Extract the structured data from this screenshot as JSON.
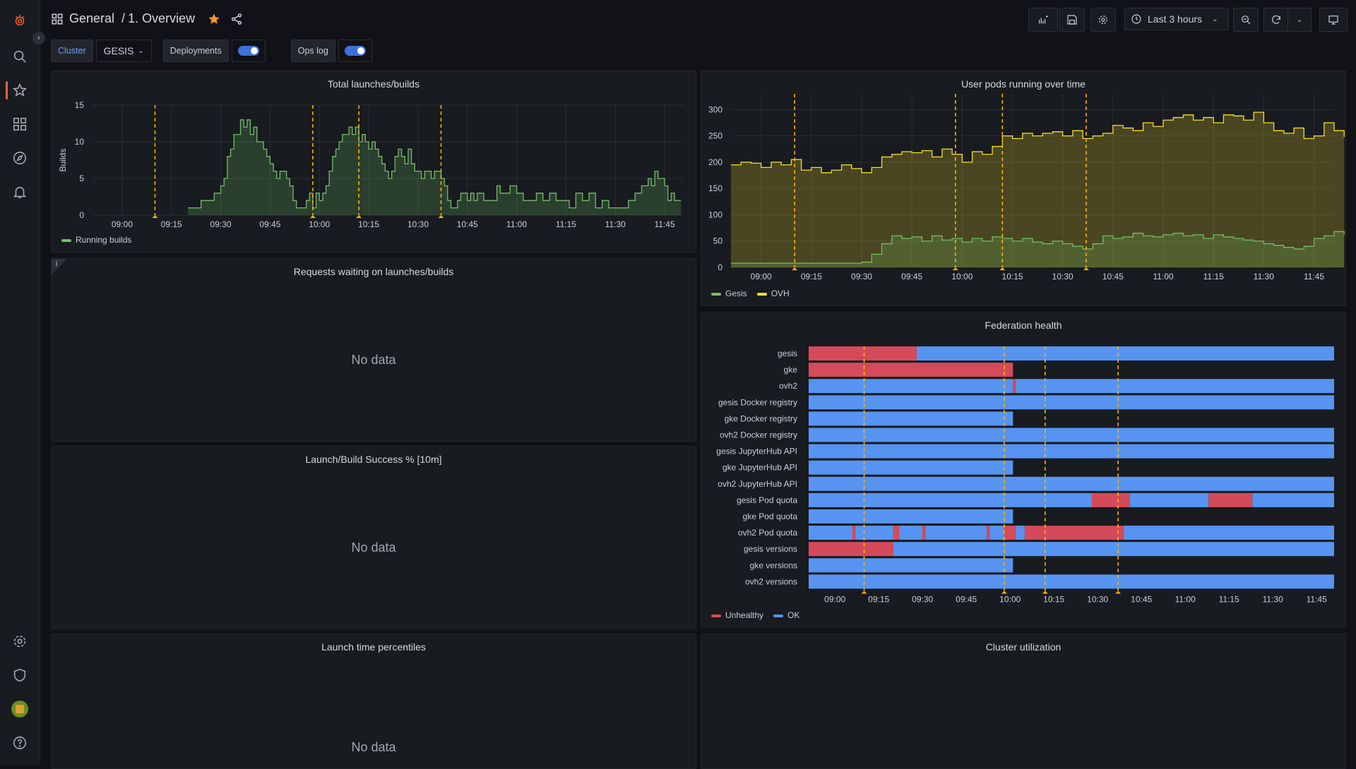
{
  "nav": {
    "icons": [
      "grafana-logo-icon",
      "search-icon",
      "starred-icon",
      "dashboards-icon",
      "explore-icon",
      "alerting-icon",
      "configuration-icon",
      "server-admin-icon",
      "user-avatar-icon",
      "help-icon"
    ]
  },
  "header": {
    "breadcrumb_folder": "General",
    "breadcrumb_sep": "/",
    "title": "1. Overview",
    "time_range": "Last 3 hours"
  },
  "variables": {
    "cluster_label": "Cluster",
    "cluster_value": "GESIS",
    "deployments_label": "Deployments",
    "opslog_label": "Ops log"
  },
  "panels": {
    "launches": {
      "title": "Total launches/builds",
      "legend": "Running builds"
    },
    "requests": {
      "title": "Requests waiting on launches/builds",
      "info": "i",
      "empty": "No data"
    },
    "success": {
      "title": "Launch/Build Success % [10m]",
      "empty": "No data"
    },
    "percentiles": {
      "title": "Launch time percentiles",
      "empty": "No data"
    },
    "userpods": {
      "title": "User pods running over time",
      "legend": [
        "Gesis",
        "OVH"
      ]
    },
    "federation": {
      "title": "Federation health",
      "legend": [
        "Unhealthy",
        "OK"
      ]
    },
    "utilization": {
      "title": "Cluster utilization"
    }
  },
  "colors": {
    "green": "#73bf69",
    "yellow": "#fade2a",
    "red": "#d44a5a",
    "blue": "#5794f2",
    "annotation": "#ffb200"
  },
  "chart_data": [
    {
      "type": "area",
      "title": "Total launches/builds",
      "ylabel": "Builds",
      "ylim": [
        0,
        15
      ],
      "yticks": [
        "0",
        "5",
        "10",
        "15"
      ],
      "xticks": [
        "09:00",
        "09:15",
        "09:30",
        "09:45",
        "10:00",
        "10:15",
        "10:30",
        "10:45",
        "11:00",
        "11:15",
        "11:30",
        "11:45"
      ],
      "x_unit_minutes": [
        0,
        15,
        30,
        45,
        60,
        75,
        90,
        105,
        120,
        135,
        150,
        165
      ],
      "annotations_minutes": [
        10,
        58,
        72,
        97
      ],
      "series": [
        {
          "name": "Running builds",
          "x": [
            20,
            24,
            28,
            30,
            31,
            32,
            33,
            34,
            35,
            36,
            37,
            38,
            39,
            40,
            41,
            42,
            43,
            44,
            45,
            46,
            47,
            48,
            49,
            50,
            51,
            52,
            53,
            54,
            55,
            56,
            57,
            58,
            59,
            60,
            61,
            62,
            63,
            64,
            65,
            66,
            67,
            68,
            69,
            70,
            71,
            72,
            73,
            74,
            75,
            76,
            77,
            78,
            79,
            80,
            81,
            82,
            83,
            84,
            85,
            86,
            87,
            88,
            89,
            90,
            91,
            92,
            93,
            94,
            95,
            96,
            97,
            98,
            99,
            100,
            101,
            102,
            103,
            104,
            105,
            106,
            107,
            108,
            110,
            112,
            114,
            115,
            116,
            118,
            120,
            122,
            124,
            126,
            128,
            130,
            132,
            134,
            136,
            138,
            140,
            142,
            144,
            146,
            148,
            150,
            152,
            154,
            156,
            158,
            160,
            161,
            162,
            163,
            164,
            165,
            166,
            167,
            168,
            170
          ],
          "y": [
            1,
            2,
            3,
            4,
            5,
            8,
            9,
            11,
            11,
            13,
            12,
            13,
            11,
            12,
            10,
            10,
            9,
            8,
            7,
            6,
            5,
            6,
            6,
            5,
            4,
            2,
            1,
            1,
            1,
            2,
            3,
            1,
            3,
            2,
            3,
            4,
            6,
            8,
            9,
            10,
            11,
            11,
            12,
            11,
            12,
            10,
            11,
            10,
            9,
            10,
            9,
            8,
            7,
            6,
            5,
            6,
            8,
            9,
            8,
            7,
            9,
            7,
            6,
            6,
            5,
            6,
            6,
            5,
            6,
            6,
            5,
            4,
            2,
            1,
            1,
            2,
            3,
            3,
            2,
            3,
            2,
            3,
            2,
            2,
            4,
            3,
            3,
            4,
            3,
            2,
            2,
            3,
            2,
            3,
            2,
            2,
            1,
            3,
            2,
            3,
            1,
            2,
            1,
            1,
            1,
            2,
            3,
            4,
            5,
            4,
            6,
            5,
            5,
            4,
            2,
            3,
            2,
            2
          ]
        }
      ]
    },
    {
      "type": "area",
      "title": "User pods running over time",
      "ylim": [
        0,
        330
      ],
      "yticks": [
        "0",
        "50",
        "100",
        "150",
        "200",
        "250",
        "300"
      ],
      "xticks": [
        "09:00",
        "09:15",
        "09:30",
        "09:45",
        "10:00",
        "10:15",
        "10:30",
        "10:45",
        "11:00",
        "11:15",
        "11:30",
        "11:45"
      ],
      "x_unit_minutes": [
        0,
        15,
        30,
        45,
        60,
        75,
        90,
        105,
        120,
        135,
        150,
        165
      ],
      "annotations_minutes": [
        10,
        58,
        72,
        97
      ],
      "series": [
        {
          "name": "OVH",
          "x": [
            -9,
            -6,
            -3,
            0,
            3,
            6,
            9,
            12,
            15,
            18,
            21,
            24,
            27,
            30,
            33,
            36,
            39,
            42,
            45,
            48,
            51,
            54,
            57,
            60,
            63,
            66,
            69,
            72,
            75,
            78,
            81,
            84,
            87,
            90,
            93,
            96,
            99,
            102,
            105,
            108,
            111,
            114,
            117,
            120,
            123,
            126,
            129,
            132,
            135,
            138,
            141,
            144,
            147,
            150,
            153,
            156,
            159,
            162,
            165,
            168,
            171,
            174
          ],
          "y": [
            195,
            200,
            198,
            190,
            200,
            195,
            205,
            185,
            190,
            180,
            185,
            195,
            188,
            180,
            190,
            210,
            215,
            220,
            218,
            222,
            210,
            225,
            215,
            200,
            220,
            215,
            230,
            250,
            245,
            255,
            250,
            255,
            258,
            250,
            260,
            245,
            250,
            255,
            270,
            265,
            260,
            275,
            268,
            280,
            285,
            290,
            280,
            285,
            275,
            290,
            288,
            280,
            295,
            275,
            260,
            255,
            265,
            245,
            250,
            275,
            260,
            248
          ]
        },
        {
          "name": "Gesis",
          "x": [
            -9,
            -6,
            -3,
            0,
            3,
            6,
            9,
            12,
            15,
            18,
            21,
            24,
            27,
            30,
            33,
            36,
            39,
            42,
            45,
            48,
            51,
            54,
            57,
            60,
            63,
            66,
            69,
            72,
            75,
            78,
            81,
            84,
            87,
            90,
            93,
            96,
            99,
            102,
            105,
            108,
            111,
            114,
            117,
            120,
            123,
            126,
            129,
            132,
            135,
            138,
            141,
            144,
            147,
            150,
            153,
            156,
            159,
            162,
            165,
            168,
            171,
            174
          ],
          "y": [
            8,
            8,
            8,
            8,
            8,
            8,
            8,
            8,
            8,
            8,
            8,
            8,
            8,
            10,
            25,
            45,
            60,
            55,
            58,
            50,
            60,
            52,
            55,
            48,
            55,
            50,
            58,
            55,
            50,
            55,
            48,
            45,
            50,
            45,
            40,
            35,
            45,
            60,
            55,
            58,
            65,
            60,
            58,
            62,
            65,
            60,
            62,
            55,
            62,
            58,
            55,
            52,
            50,
            45,
            42,
            38,
            35,
            40,
            55,
            60,
            68,
            62
          ]
        }
      ]
    },
    {
      "type": "state-timeline",
      "title": "Federation health",
      "xticks": [
        "09:00",
        "09:15",
        "09:30",
        "09:45",
        "10:00",
        "10:15",
        "10:30",
        "10:45",
        "11:00",
        "11:15",
        "11:30",
        "11:45"
      ],
      "x_unit_minutes": [
        0,
        15,
        30,
        45,
        60,
        75,
        90,
        105,
        120,
        135,
        150,
        165
      ],
      "x_range_minutes": [
        -9,
        171
      ],
      "annotations_minutes": [
        10,
        58,
        72,
        97
      ],
      "states": [
        "Unhealthy",
        "OK"
      ],
      "rows": [
        {
          "name": "gesis",
          "segments": [
            [
              -9,
              28,
              "Unhealthy"
            ],
            [
              28,
              171,
              "OK"
            ]
          ]
        },
        {
          "name": "gke",
          "segments": [
            [
              -9,
              61,
              "Unhealthy"
            ]
          ]
        },
        {
          "name": "ovh2",
          "segments": [
            [
              -9,
              61,
              "OK"
            ],
            [
              61,
              62,
              "Unhealthy"
            ],
            [
              62,
              171,
              "OK"
            ]
          ]
        },
        {
          "name": "gesis Docker registry",
          "segments": [
            [
              -9,
              171,
              "OK"
            ]
          ]
        },
        {
          "name": "gke Docker registry",
          "segments": [
            [
              -9,
              61,
              "OK"
            ]
          ]
        },
        {
          "name": "ovh2 Docker registry",
          "segments": [
            [
              -9,
              171,
              "OK"
            ]
          ]
        },
        {
          "name": "gesis JupyterHub API",
          "segments": [
            [
              -9,
              171,
              "OK"
            ]
          ]
        },
        {
          "name": "gke JupyterHub API",
          "segments": [
            [
              -9,
              61,
              "OK"
            ]
          ]
        },
        {
          "name": "ovh2 JupyterHub API",
          "segments": [
            [
              -9,
              171,
              "OK"
            ]
          ]
        },
        {
          "name": "gesis Pod quota",
          "segments": [
            [
              -9,
              88,
              "OK"
            ],
            [
              88,
              101,
              "Unhealthy"
            ],
            [
              101,
              128,
              "OK"
            ],
            [
              128,
              143,
              "Unhealthy"
            ],
            [
              143,
              171,
              "OK"
            ]
          ]
        },
        {
          "name": "gke Pod quota",
          "segments": [
            [
              -9,
              61,
              "OK"
            ]
          ]
        },
        {
          "name": "ovh2 Pod quota",
          "segments": [
            [
              -9,
              6,
              "OK"
            ],
            [
              6,
              7,
              "Unhealthy"
            ],
            [
              7,
              20,
              "OK"
            ],
            [
              20,
              22,
              "Unhealthy"
            ],
            [
              22,
              30,
              "OK"
            ],
            [
              30,
              31,
              "Unhealthy"
            ],
            [
              31,
              52,
              "OK"
            ],
            [
              52,
              53,
              "Unhealthy"
            ],
            [
              53,
              58,
              "OK"
            ],
            [
              58,
              62,
              "Unhealthy"
            ],
            [
              62,
              65,
              "OK"
            ],
            [
              65,
              99,
              "Unhealthy"
            ],
            [
              99,
              171,
              "OK"
            ]
          ]
        },
        {
          "name": "gesis versions",
          "segments": [
            [
              -9,
              20,
              "Unhealthy"
            ],
            [
              20,
              171,
              "OK"
            ]
          ]
        },
        {
          "name": "gke versions",
          "segments": [
            [
              -9,
              61,
              "OK"
            ]
          ]
        },
        {
          "name": "ovh2 versions",
          "segments": [
            [
              -9,
              171,
              "OK"
            ]
          ]
        }
      ]
    }
  ]
}
